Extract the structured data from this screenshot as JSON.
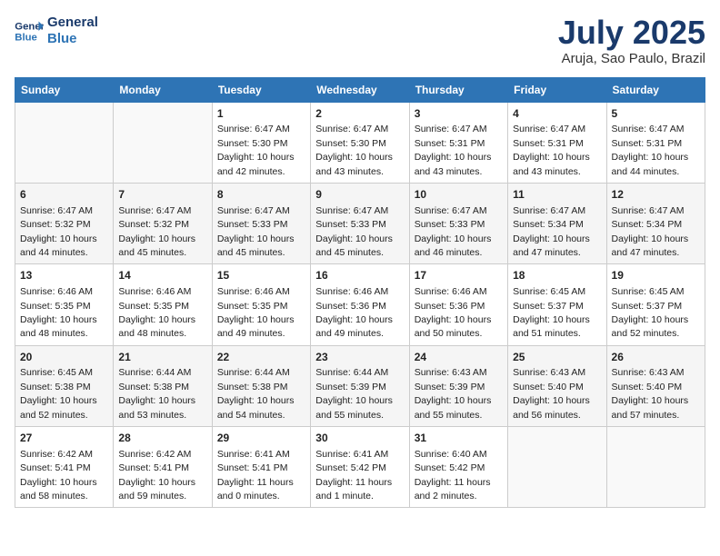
{
  "header": {
    "logo_line1": "General",
    "logo_line2": "Blue",
    "month_year": "July 2025",
    "location": "Aruja, Sao Paulo, Brazil"
  },
  "days_of_week": [
    "Sunday",
    "Monday",
    "Tuesday",
    "Wednesday",
    "Thursday",
    "Friday",
    "Saturday"
  ],
  "weeks": [
    [
      {
        "day": "",
        "sunrise": "",
        "sunset": "",
        "daylight": ""
      },
      {
        "day": "",
        "sunrise": "",
        "sunset": "",
        "daylight": ""
      },
      {
        "day": "1",
        "sunrise": "Sunrise: 6:47 AM",
        "sunset": "Sunset: 5:30 PM",
        "daylight": "Daylight: 10 hours and 42 minutes."
      },
      {
        "day": "2",
        "sunrise": "Sunrise: 6:47 AM",
        "sunset": "Sunset: 5:30 PM",
        "daylight": "Daylight: 10 hours and 43 minutes."
      },
      {
        "day": "3",
        "sunrise": "Sunrise: 6:47 AM",
        "sunset": "Sunset: 5:31 PM",
        "daylight": "Daylight: 10 hours and 43 minutes."
      },
      {
        "day": "4",
        "sunrise": "Sunrise: 6:47 AM",
        "sunset": "Sunset: 5:31 PM",
        "daylight": "Daylight: 10 hours and 43 minutes."
      },
      {
        "day": "5",
        "sunrise": "Sunrise: 6:47 AM",
        "sunset": "Sunset: 5:31 PM",
        "daylight": "Daylight: 10 hours and 44 minutes."
      }
    ],
    [
      {
        "day": "6",
        "sunrise": "Sunrise: 6:47 AM",
        "sunset": "Sunset: 5:32 PM",
        "daylight": "Daylight: 10 hours and 44 minutes."
      },
      {
        "day": "7",
        "sunrise": "Sunrise: 6:47 AM",
        "sunset": "Sunset: 5:32 PM",
        "daylight": "Daylight: 10 hours and 45 minutes."
      },
      {
        "day": "8",
        "sunrise": "Sunrise: 6:47 AM",
        "sunset": "Sunset: 5:33 PM",
        "daylight": "Daylight: 10 hours and 45 minutes."
      },
      {
        "day": "9",
        "sunrise": "Sunrise: 6:47 AM",
        "sunset": "Sunset: 5:33 PM",
        "daylight": "Daylight: 10 hours and 45 minutes."
      },
      {
        "day": "10",
        "sunrise": "Sunrise: 6:47 AM",
        "sunset": "Sunset: 5:33 PM",
        "daylight": "Daylight: 10 hours and 46 minutes."
      },
      {
        "day": "11",
        "sunrise": "Sunrise: 6:47 AM",
        "sunset": "Sunset: 5:34 PM",
        "daylight": "Daylight: 10 hours and 47 minutes."
      },
      {
        "day": "12",
        "sunrise": "Sunrise: 6:47 AM",
        "sunset": "Sunset: 5:34 PM",
        "daylight": "Daylight: 10 hours and 47 minutes."
      }
    ],
    [
      {
        "day": "13",
        "sunrise": "Sunrise: 6:46 AM",
        "sunset": "Sunset: 5:35 PM",
        "daylight": "Daylight: 10 hours and 48 minutes."
      },
      {
        "day": "14",
        "sunrise": "Sunrise: 6:46 AM",
        "sunset": "Sunset: 5:35 PM",
        "daylight": "Daylight: 10 hours and 48 minutes."
      },
      {
        "day": "15",
        "sunrise": "Sunrise: 6:46 AM",
        "sunset": "Sunset: 5:35 PM",
        "daylight": "Daylight: 10 hours and 49 minutes."
      },
      {
        "day": "16",
        "sunrise": "Sunrise: 6:46 AM",
        "sunset": "Sunset: 5:36 PM",
        "daylight": "Daylight: 10 hours and 49 minutes."
      },
      {
        "day": "17",
        "sunrise": "Sunrise: 6:46 AM",
        "sunset": "Sunset: 5:36 PM",
        "daylight": "Daylight: 10 hours and 50 minutes."
      },
      {
        "day": "18",
        "sunrise": "Sunrise: 6:45 AM",
        "sunset": "Sunset: 5:37 PM",
        "daylight": "Daylight: 10 hours and 51 minutes."
      },
      {
        "day": "19",
        "sunrise": "Sunrise: 6:45 AM",
        "sunset": "Sunset: 5:37 PM",
        "daylight": "Daylight: 10 hours and 52 minutes."
      }
    ],
    [
      {
        "day": "20",
        "sunrise": "Sunrise: 6:45 AM",
        "sunset": "Sunset: 5:38 PM",
        "daylight": "Daylight: 10 hours and 52 minutes."
      },
      {
        "day": "21",
        "sunrise": "Sunrise: 6:44 AM",
        "sunset": "Sunset: 5:38 PM",
        "daylight": "Daylight: 10 hours and 53 minutes."
      },
      {
        "day": "22",
        "sunrise": "Sunrise: 6:44 AM",
        "sunset": "Sunset: 5:38 PM",
        "daylight": "Daylight: 10 hours and 54 minutes."
      },
      {
        "day": "23",
        "sunrise": "Sunrise: 6:44 AM",
        "sunset": "Sunset: 5:39 PM",
        "daylight": "Daylight: 10 hours and 55 minutes."
      },
      {
        "day": "24",
        "sunrise": "Sunrise: 6:43 AM",
        "sunset": "Sunset: 5:39 PM",
        "daylight": "Daylight: 10 hours and 55 minutes."
      },
      {
        "day": "25",
        "sunrise": "Sunrise: 6:43 AM",
        "sunset": "Sunset: 5:40 PM",
        "daylight": "Daylight: 10 hours and 56 minutes."
      },
      {
        "day": "26",
        "sunrise": "Sunrise: 6:43 AM",
        "sunset": "Sunset: 5:40 PM",
        "daylight": "Daylight: 10 hours and 57 minutes."
      }
    ],
    [
      {
        "day": "27",
        "sunrise": "Sunrise: 6:42 AM",
        "sunset": "Sunset: 5:41 PM",
        "daylight": "Daylight: 10 hours and 58 minutes."
      },
      {
        "day": "28",
        "sunrise": "Sunrise: 6:42 AM",
        "sunset": "Sunset: 5:41 PM",
        "daylight": "Daylight: 10 hours and 59 minutes."
      },
      {
        "day": "29",
        "sunrise": "Sunrise: 6:41 AM",
        "sunset": "Sunset: 5:41 PM",
        "daylight": "Daylight: 11 hours and 0 minutes."
      },
      {
        "day": "30",
        "sunrise": "Sunrise: 6:41 AM",
        "sunset": "Sunset: 5:42 PM",
        "daylight": "Daylight: 11 hours and 1 minute."
      },
      {
        "day": "31",
        "sunrise": "Sunrise: 6:40 AM",
        "sunset": "Sunset: 5:42 PM",
        "daylight": "Daylight: 11 hours and 2 minutes."
      },
      {
        "day": "",
        "sunrise": "",
        "sunset": "",
        "daylight": ""
      },
      {
        "day": "",
        "sunrise": "",
        "sunset": "",
        "daylight": ""
      }
    ]
  ]
}
